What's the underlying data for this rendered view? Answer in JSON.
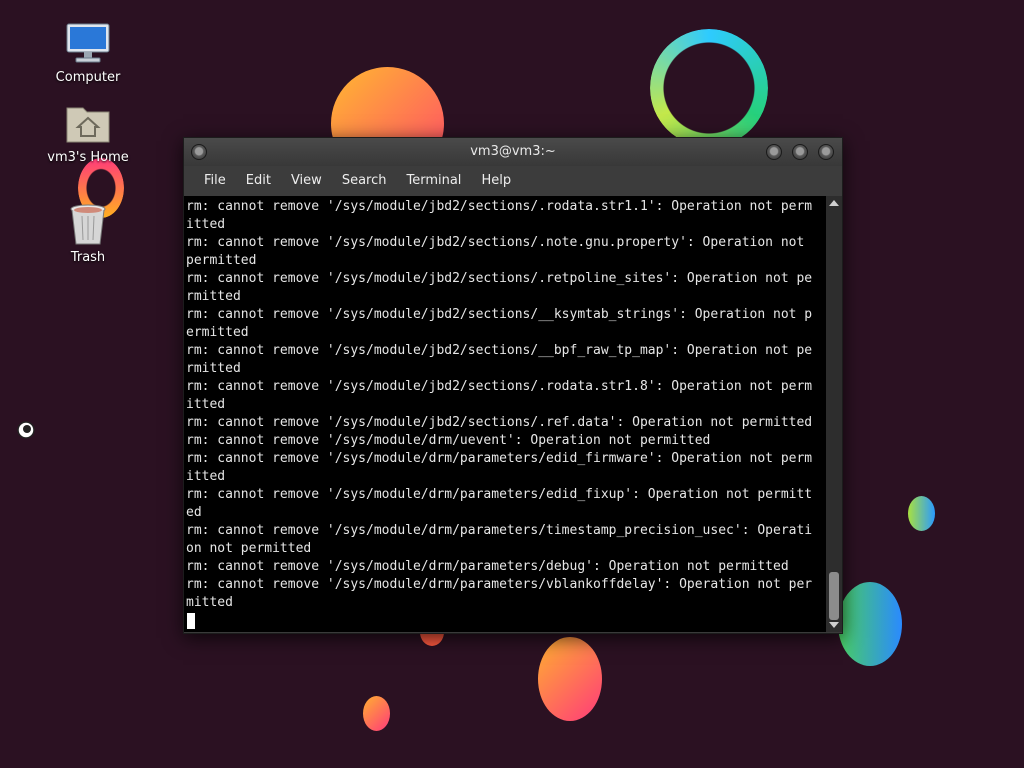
{
  "desktop": {
    "icons": [
      {
        "label": "Computer",
        "icon": "computer-icon"
      },
      {
        "label": "vm3's Home",
        "icon": "home-folder-icon"
      },
      {
        "label": "Trash",
        "icon": "trash-icon"
      }
    ]
  },
  "window": {
    "title": "vm3@vm3:~",
    "menu": [
      "File",
      "Edit",
      "View",
      "Search",
      "Terminal",
      "Help"
    ]
  },
  "terminal": {
    "lines": [
      "rm: cannot remove '/sys/module/jbd2/sections/.rodata.str1.1': Operation not perm",
      "itted",
      "rm: cannot remove '/sys/module/jbd2/sections/.note.gnu.property': Operation not ",
      "permitted",
      "rm: cannot remove '/sys/module/jbd2/sections/.retpoline_sites': Operation not pe",
      "rmitted",
      "rm: cannot remove '/sys/module/jbd2/sections/__ksymtab_strings': Operation not p",
      "ermitted",
      "rm: cannot remove '/sys/module/jbd2/sections/__bpf_raw_tp_map': Operation not pe",
      "rmitted",
      "rm: cannot remove '/sys/module/jbd2/sections/.rodata.str1.8': Operation not perm",
      "itted",
      "rm: cannot remove '/sys/module/jbd2/sections/.ref.data': Operation not permitted",
      "rm: cannot remove '/sys/module/drm/uevent': Operation not permitted",
      "rm: cannot remove '/sys/module/drm/parameters/edid_firmware': Operation not perm",
      "itted",
      "rm: cannot remove '/sys/module/drm/parameters/edid_fixup': Operation not permitt",
      "ed",
      "rm: cannot remove '/sys/module/drm/parameters/timestamp_precision_usec': Operati",
      "on not permitted",
      "rm: cannot remove '/sys/module/drm/parameters/debug': Operation not permitted",
      "rm: cannot remove '/sys/module/drm/parameters/vblankoffdelay': Operation not per",
      "mitted"
    ]
  },
  "colors": {
    "background": "#2b1122",
    "terminal_bg": "#000000",
    "terminal_fg": "#e6e6e6"
  }
}
